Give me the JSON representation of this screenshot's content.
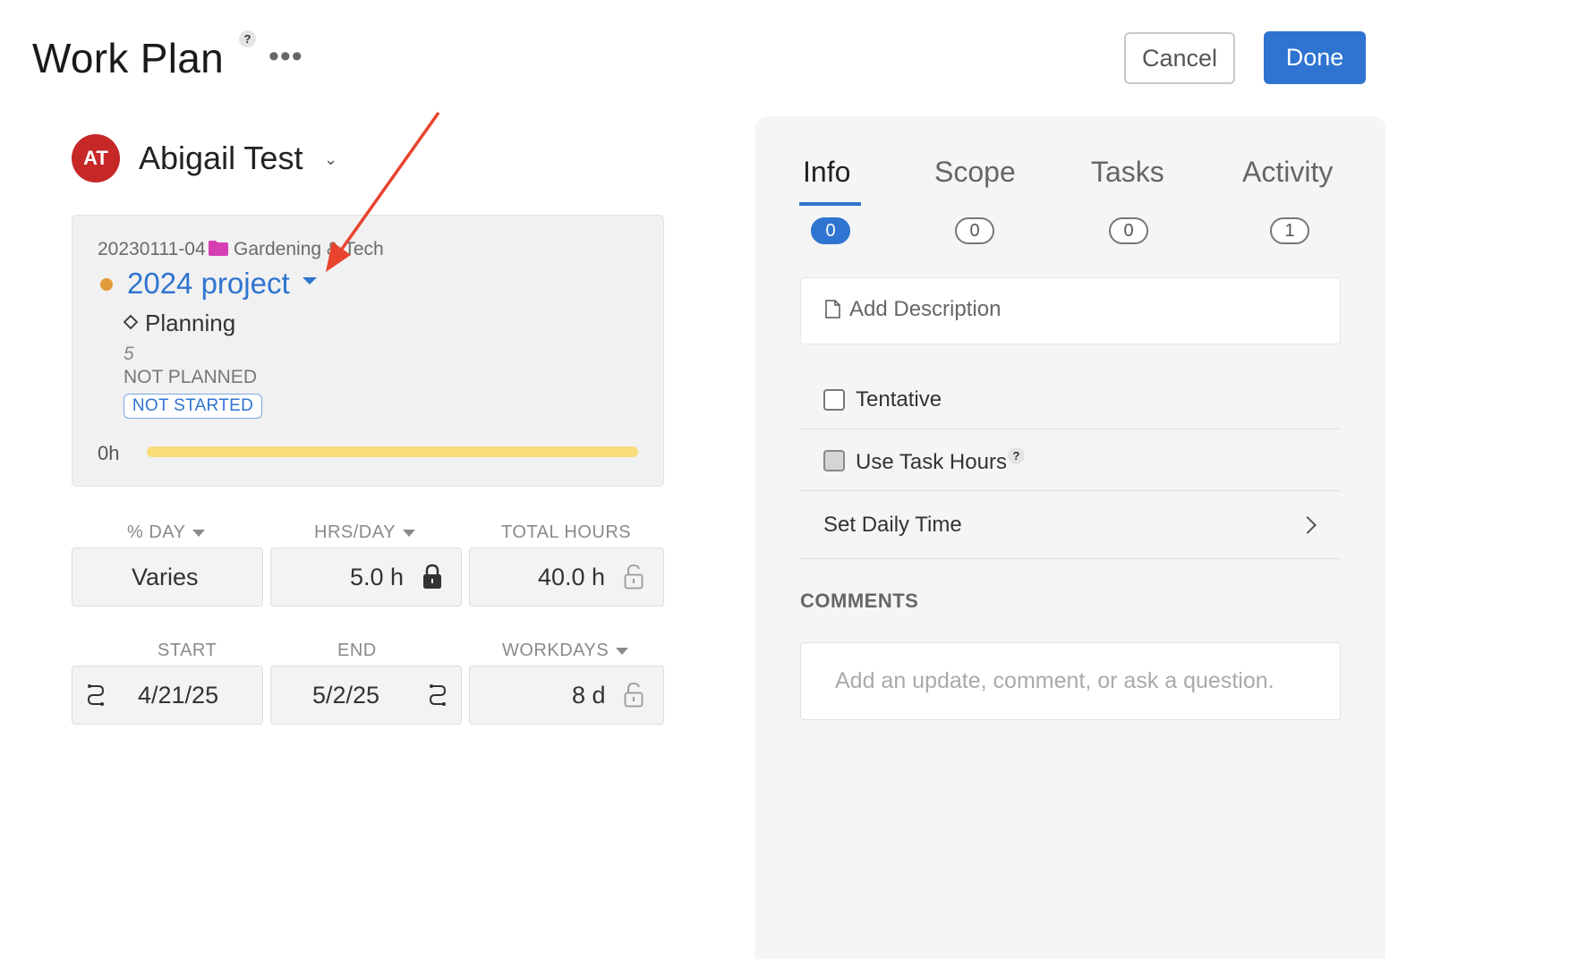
{
  "header": {
    "title": "Work Plan",
    "help": "?",
    "more": "•••",
    "cancel_label": "Cancel",
    "done_label": "Done"
  },
  "person": {
    "initials": "AT",
    "name": "Abigail Test",
    "avatar_color": "#c62828"
  },
  "project": {
    "code": "20230111-04",
    "client": "Gardening & Tech",
    "name": "2024 project",
    "status_dot_color": "#e39a3b",
    "folder_color": "#d63fb4",
    "phase": "Planning",
    "phase_number": "5",
    "plan_status": "NOT PLANNED",
    "work_status": "NOT STARTED",
    "hours": "0h",
    "accent_color": "#2f74d0"
  },
  "metrics": {
    "pct_day_label": "% DAY",
    "pct_day_value": "Varies",
    "hrs_day_label": "HRS/DAY",
    "hrs_day_value": "5.0 h",
    "total_hours_label": "TOTAL HOURS",
    "total_hours_value": "40.0 h",
    "start_label": "START",
    "start_value": "4/21/25",
    "end_label": "END",
    "end_value": "5/2/25",
    "workdays_label": "WORKDAYS",
    "workdays_value": "8 d"
  },
  "panel": {
    "tabs": [
      {
        "label": "Info",
        "count": "0",
        "active": true
      },
      {
        "label": "Scope",
        "count": "0"
      },
      {
        "label": "Tasks",
        "count": "0"
      },
      {
        "label": "Activity",
        "count": "1"
      }
    ],
    "add_description": "Add Description",
    "tentative_label": "Tentative",
    "use_task_hours_label": "Use Task Hours",
    "help": "?",
    "set_daily_time_label": "Set Daily Time",
    "comments_heading": "COMMENTS",
    "comment_placeholder": "Add an update, comment, or ask a question."
  },
  "annotation": {
    "arrow_color": "#e8442f"
  }
}
